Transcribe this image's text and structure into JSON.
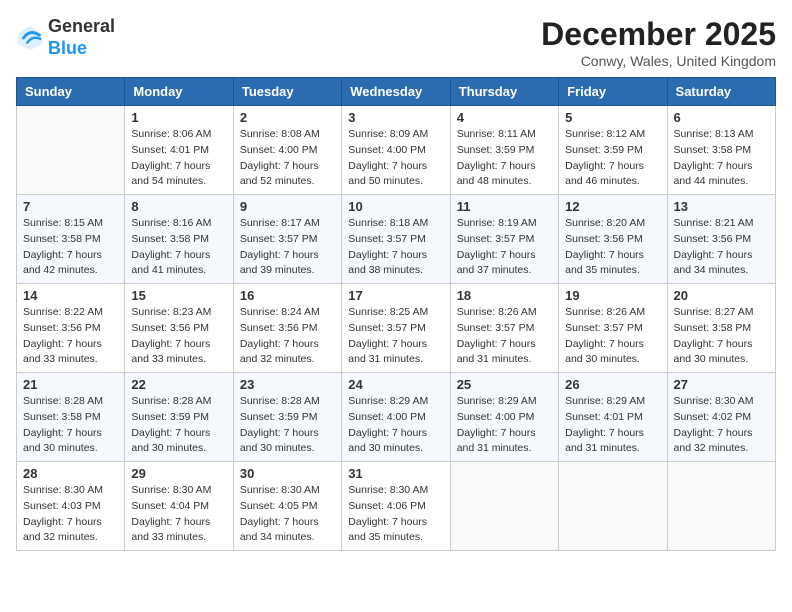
{
  "header": {
    "logo_general": "General",
    "logo_blue": "Blue",
    "month_year": "December 2025",
    "location": "Conwy, Wales, United Kingdom"
  },
  "weekdays": [
    "Sunday",
    "Monday",
    "Tuesday",
    "Wednesday",
    "Thursday",
    "Friday",
    "Saturday"
  ],
  "weeks": [
    [
      {
        "day": "",
        "sunrise": "",
        "sunset": "",
        "daylight": ""
      },
      {
        "day": "1",
        "sunrise": "Sunrise: 8:06 AM",
        "sunset": "Sunset: 4:01 PM",
        "daylight": "Daylight: 7 hours and 54 minutes."
      },
      {
        "day": "2",
        "sunrise": "Sunrise: 8:08 AM",
        "sunset": "Sunset: 4:00 PM",
        "daylight": "Daylight: 7 hours and 52 minutes."
      },
      {
        "day": "3",
        "sunrise": "Sunrise: 8:09 AM",
        "sunset": "Sunset: 4:00 PM",
        "daylight": "Daylight: 7 hours and 50 minutes."
      },
      {
        "day": "4",
        "sunrise": "Sunrise: 8:11 AM",
        "sunset": "Sunset: 3:59 PM",
        "daylight": "Daylight: 7 hours and 48 minutes."
      },
      {
        "day": "5",
        "sunrise": "Sunrise: 8:12 AM",
        "sunset": "Sunset: 3:59 PM",
        "daylight": "Daylight: 7 hours and 46 minutes."
      },
      {
        "day": "6",
        "sunrise": "Sunrise: 8:13 AM",
        "sunset": "Sunset: 3:58 PM",
        "daylight": "Daylight: 7 hours and 44 minutes."
      }
    ],
    [
      {
        "day": "7",
        "sunrise": "Sunrise: 8:15 AM",
        "sunset": "Sunset: 3:58 PM",
        "daylight": "Daylight: 7 hours and 42 minutes."
      },
      {
        "day": "8",
        "sunrise": "Sunrise: 8:16 AM",
        "sunset": "Sunset: 3:58 PM",
        "daylight": "Daylight: 7 hours and 41 minutes."
      },
      {
        "day": "9",
        "sunrise": "Sunrise: 8:17 AM",
        "sunset": "Sunset: 3:57 PM",
        "daylight": "Daylight: 7 hours and 39 minutes."
      },
      {
        "day": "10",
        "sunrise": "Sunrise: 8:18 AM",
        "sunset": "Sunset: 3:57 PM",
        "daylight": "Daylight: 7 hours and 38 minutes."
      },
      {
        "day": "11",
        "sunrise": "Sunrise: 8:19 AM",
        "sunset": "Sunset: 3:57 PM",
        "daylight": "Daylight: 7 hours and 37 minutes."
      },
      {
        "day": "12",
        "sunrise": "Sunrise: 8:20 AM",
        "sunset": "Sunset: 3:56 PM",
        "daylight": "Daylight: 7 hours and 35 minutes."
      },
      {
        "day": "13",
        "sunrise": "Sunrise: 8:21 AM",
        "sunset": "Sunset: 3:56 PM",
        "daylight": "Daylight: 7 hours and 34 minutes."
      }
    ],
    [
      {
        "day": "14",
        "sunrise": "Sunrise: 8:22 AM",
        "sunset": "Sunset: 3:56 PM",
        "daylight": "Daylight: 7 hours and 33 minutes."
      },
      {
        "day": "15",
        "sunrise": "Sunrise: 8:23 AM",
        "sunset": "Sunset: 3:56 PM",
        "daylight": "Daylight: 7 hours and 33 minutes."
      },
      {
        "day": "16",
        "sunrise": "Sunrise: 8:24 AM",
        "sunset": "Sunset: 3:56 PM",
        "daylight": "Daylight: 7 hours and 32 minutes."
      },
      {
        "day": "17",
        "sunrise": "Sunrise: 8:25 AM",
        "sunset": "Sunset: 3:57 PM",
        "daylight": "Daylight: 7 hours and 31 minutes."
      },
      {
        "day": "18",
        "sunrise": "Sunrise: 8:26 AM",
        "sunset": "Sunset: 3:57 PM",
        "daylight": "Daylight: 7 hours and 31 minutes."
      },
      {
        "day": "19",
        "sunrise": "Sunrise: 8:26 AM",
        "sunset": "Sunset: 3:57 PM",
        "daylight": "Daylight: 7 hours and 30 minutes."
      },
      {
        "day": "20",
        "sunrise": "Sunrise: 8:27 AM",
        "sunset": "Sunset: 3:58 PM",
        "daylight": "Daylight: 7 hours and 30 minutes."
      }
    ],
    [
      {
        "day": "21",
        "sunrise": "Sunrise: 8:28 AM",
        "sunset": "Sunset: 3:58 PM",
        "daylight": "Daylight: 7 hours and 30 minutes."
      },
      {
        "day": "22",
        "sunrise": "Sunrise: 8:28 AM",
        "sunset": "Sunset: 3:59 PM",
        "daylight": "Daylight: 7 hours and 30 minutes."
      },
      {
        "day": "23",
        "sunrise": "Sunrise: 8:28 AM",
        "sunset": "Sunset: 3:59 PM",
        "daylight": "Daylight: 7 hours and 30 minutes."
      },
      {
        "day": "24",
        "sunrise": "Sunrise: 8:29 AM",
        "sunset": "Sunset: 4:00 PM",
        "daylight": "Daylight: 7 hours and 30 minutes."
      },
      {
        "day": "25",
        "sunrise": "Sunrise: 8:29 AM",
        "sunset": "Sunset: 4:00 PM",
        "daylight": "Daylight: 7 hours and 31 minutes."
      },
      {
        "day": "26",
        "sunrise": "Sunrise: 8:29 AM",
        "sunset": "Sunset: 4:01 PM",
        "daylight": "Daylight: 7 hours and 31 minutes."
      },
      {
        "day": "27",
        "sunrise": "Sunrise: 8:30 AM",
        "sunset": "Sunset: 4:02 PM",
        "daylight": "Daylight: 7 hours and 32 minutes."
      }
    ],
    [
      {
        "day": "28",
        "sunrise": "Sunrise: 8:30 AM",
        "sunset": "Sunset: 4:03 PM",
        "daylight": "Daylight: 7 hours and 32 minutes."
      },
      {
        "day": "29",
        "sunrise": "Sunrise: 8:30 AM",
        "sunset": "Sunset: 4:04 PM",
        "daylight": "Daylight: 7 hours and 33 minutes."
      },
      {
        "day": "30",
        "sunrise": "Sunrise: 8:30 AM",
        "sunset": "Sunset: 4:05 PM",
        "daylight": "Daylight: 7 hours and 34 minutes."
      },
      {
        "day": "31",
        "sunrise": "Sunrise: 8:30 AM",
        "sunset": "Sunset: 4:06 PM",
        "daylight": "Daylight: 7 hours and 35 minutes."
      },
      {
        "day": "",
        "sunrise": "",
        "sunset": "",
        "daylight": ""
      },
      {
        "day": "",
        "sunrise": "",
        "sunset": "",
        "daylight": ""
      },
      {
        "day": "",
        "sunrise": "",
        "sunset": "",
        "daylight": ""
      }
    ]
  ]
}
